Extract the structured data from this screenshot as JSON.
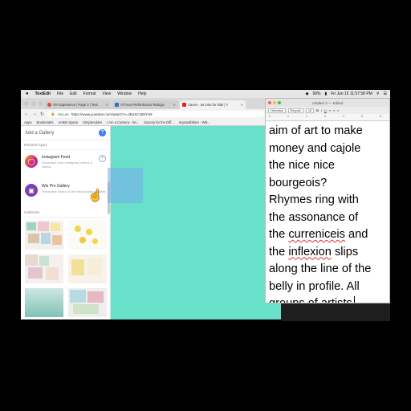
{
  "menubar": {
    "apple": "",
    "app_name": "TextEdit",
    "items": [
      "File",
      "Edit",
      "Format",
      "View",
      "Window",
      "Help"
    ],
    "datetime": "Fri Jun 15  11:57:58 PM",
    "battery": "99%"
  },
  "browser": {
    "tabs": [
      {
        "label": "VR Experience | Page 3 | Test",
        "icon_color": "#e8453c"
      },
      {
        "label": "All Your Performance Ratings",
        "icon_color": "#2b6fd6"
      },
      {
        "label": "Caves - an intro for kids | Y",
        "icon_color": "#e62117"
      }
    ],
    "address": {
      "secure_label": "Secure",
      "url": "https://www.youtube.com/watch?v=3EaSCs89YH8"
    },
    "bookmarks": [
      "Apps",
      "Bookmarks",
      "Artists Space",
      "SimpleAdder",
      "I Am a Camera - Wi...",
      "Society for the Diff...",
      "Impossibilism - Wik..."
    ]
  },
  "panel": {
    "title": "Add a Gallery",
    "related_title": "Related Apps",
    "apps": [
      {
        "name": "Instagram Feed",
        "desc": "Showcase your Instagram photos & videos",
        "icon_color": "#d6296e"
      },
      {
        "name": "Wix Pro Gallery",
        "desc": "Showcase photos in the best quality possible",
        "icon_color": "#7b3fb5"
      }
    ],
    "galleries_title": "Galleries"
  },
  "textedit": {
    "title": "Untitled 3 — Edited",
    "format": {
      "style": "Helvetica",
      "weight": "Regular",
      "size": "18"
    },
    "ruler": [
      "0",
      "1",
      "2",
      "3",
      "4",
      "5",
      "6"
    ],
    "lines": [
      "aim of art to make",
      "money and cajole",
      "the nice nice",
      "bourgeois?",
      "Rhymes ring with",
      "the assonance of",
      "the curreniceis and",
      "the inflexion slips",
      "along the line of the",
      "belly in profile. All",
      "groups of artists"
    ],
    "misspelled": [
      "curreniceis",
      "inflexion"
    ]
  },
  "colors": {
    "video_bg": "#69e0c9",
    "accent": "#3b7cf0"
  }
}
